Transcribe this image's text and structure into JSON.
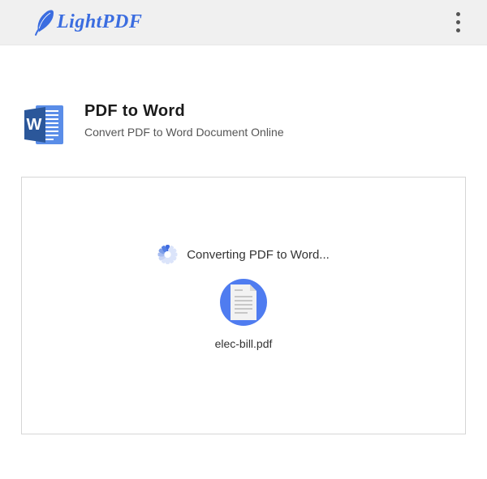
{
  "header": {
    "brand": "LightPDF"
  },
  "page": {
    "title": "PDF to Word",
    "subtitle": "Convert PDF to Word Document Online"
  },
  "conversion": {
    "status": "Converting PDF to Word...",
    "filename": "elec-bill.pdf"
  },
  "icons": {
    "word_icon": "word-document-icon",
    "spinner": "loading-spinner-icon",
    "file_thumb": "document-file-icon",
    "kebab": "more-vertical-icon"
  },
  "colors": {
    "brand": "#3b6de0",
    "word_blue": "#2b579a",
    "accent_blue": "#4f7cf0"
  }
}
